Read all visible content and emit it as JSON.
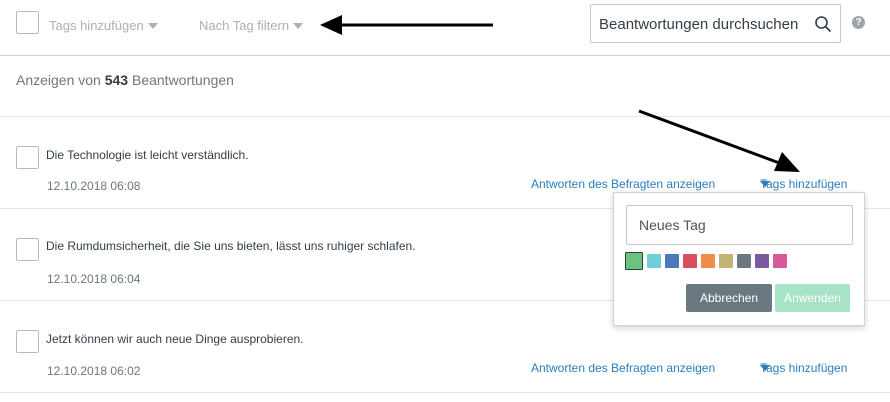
{
  "toolbar": {
    "add_tags_label": "Tags hinzufügen",
    "filter_by_tag_label": "Nach Tag filtern",
    "search_placeholder": "Beantwortungen durchsuchen"
  },
  "summary": {
    "prefix": "Anzeigen von",
    "count": "543",
    "suffix": "Beantwortungen"
  },
  "responses": [
    {
      "text": "Die Technologie ist leicht verständlich.",
      "timestamp": "12.10.2018 06:08",
      "view_link": "Antworten des Befragten anzeigen",
      "tags_link": "Tags hinzufügen"
    },
    {
      "text": "Die Rumdumsicherheit, die Sie uns bieten, lässt uns ruhiger schlafen.",
      "timestamp": "12.10.2018 06:04"
    },
    {
      "text": "Jetzt können wir auch neue Dinge ausprobieren.",
      "timestamp": "12.10.2018 06:02",
      "view_link": "Antworten des Befragten anzeigen",
      "tags_link": "Tags hinzufügen"
    }
  ],
  "tag_popover": {
    "input_placeholder": "Neues Tag",
    "colors": [
      "#6ac47f",
      "#6fcfd4",
      "#4a78b8",
      "#d94f5c",
      "#ef8d4d",
      "#c3b374",
      "#6b787f",
      "#7a5a9e",
      "#d95a9b"
    ],
    "selected_color_index": 0,
    "cancel_label": "Abbrechen",
    "apply_label": "Anwenden"
  },
  "accent_colors": {
    "link": "#2b7ec1",
    "cancel": "#6b787f",
    "apply_disabled": "#a7e4c7"
  }
}
